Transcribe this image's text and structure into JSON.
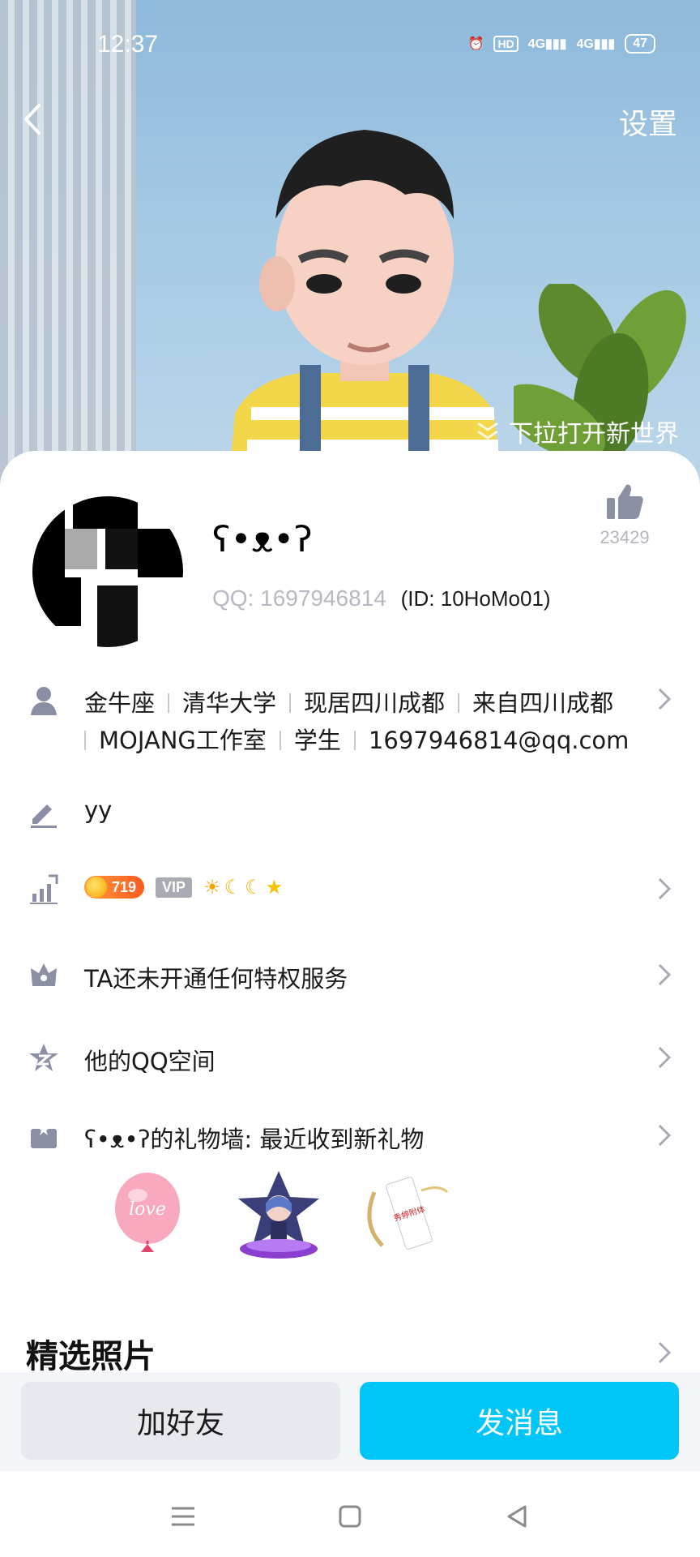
{
  "status_bar": {
    "time": "12:37",
    "hd": "HD",
    "net1": "4G",
    "net2": "4G",
    "battery": "47"
  },
  "header": {
    "settings_label": "设置",
    "pull_hint": "下拉打开新世界"
  },
  "profile": {
    "nickname": "ʕ•ᴥ•ʔ",
    "qq_label": "QQ: 1697946814",
    "id_label": "(ID: 10HoMo01)",
    "like_count": "23429"
  },
  "info": {
    "items_line1": [
      "金牛座",
      "清华大学",
      "现居四川成都",
      "来自四川成都"
    ],
    "items_line2": [
      "MOJANG工作室",
      "学生",
      "1697946814@qq.com"
    ]
  },
  "signature": "yy",
  "level": {
    "level_num": "719",
    "vip_label": "VIP",
    "icons": [
      "☀",
      "☾",
      "☾",
      "★"
    ]
  },
  "privilege": "TA还未开通任何特权服务",
  "qzone": "他的QQ空间",
  "gift_wall": "ʕ•ᴥ•ʔ的礼物墙: 最近收到新礼物",
  "gifts": [
    {
      "name": "love",
      "text": "love"
    },
    {
      "name": "figure"
    },
    {
      "name": "charm",
      "text": "秀婷附体"
    }
  ],
  "photos_title": "精选照片",
  "actions": {
    "add_friend": "加好友",
    "send_message": "发消息"
  },
  "colors": {
    "accent": "#00C6F7",
    "secondary_btn": "#E7E9EF",
    "icon_gray": "#8A8FA3"
  }
}
